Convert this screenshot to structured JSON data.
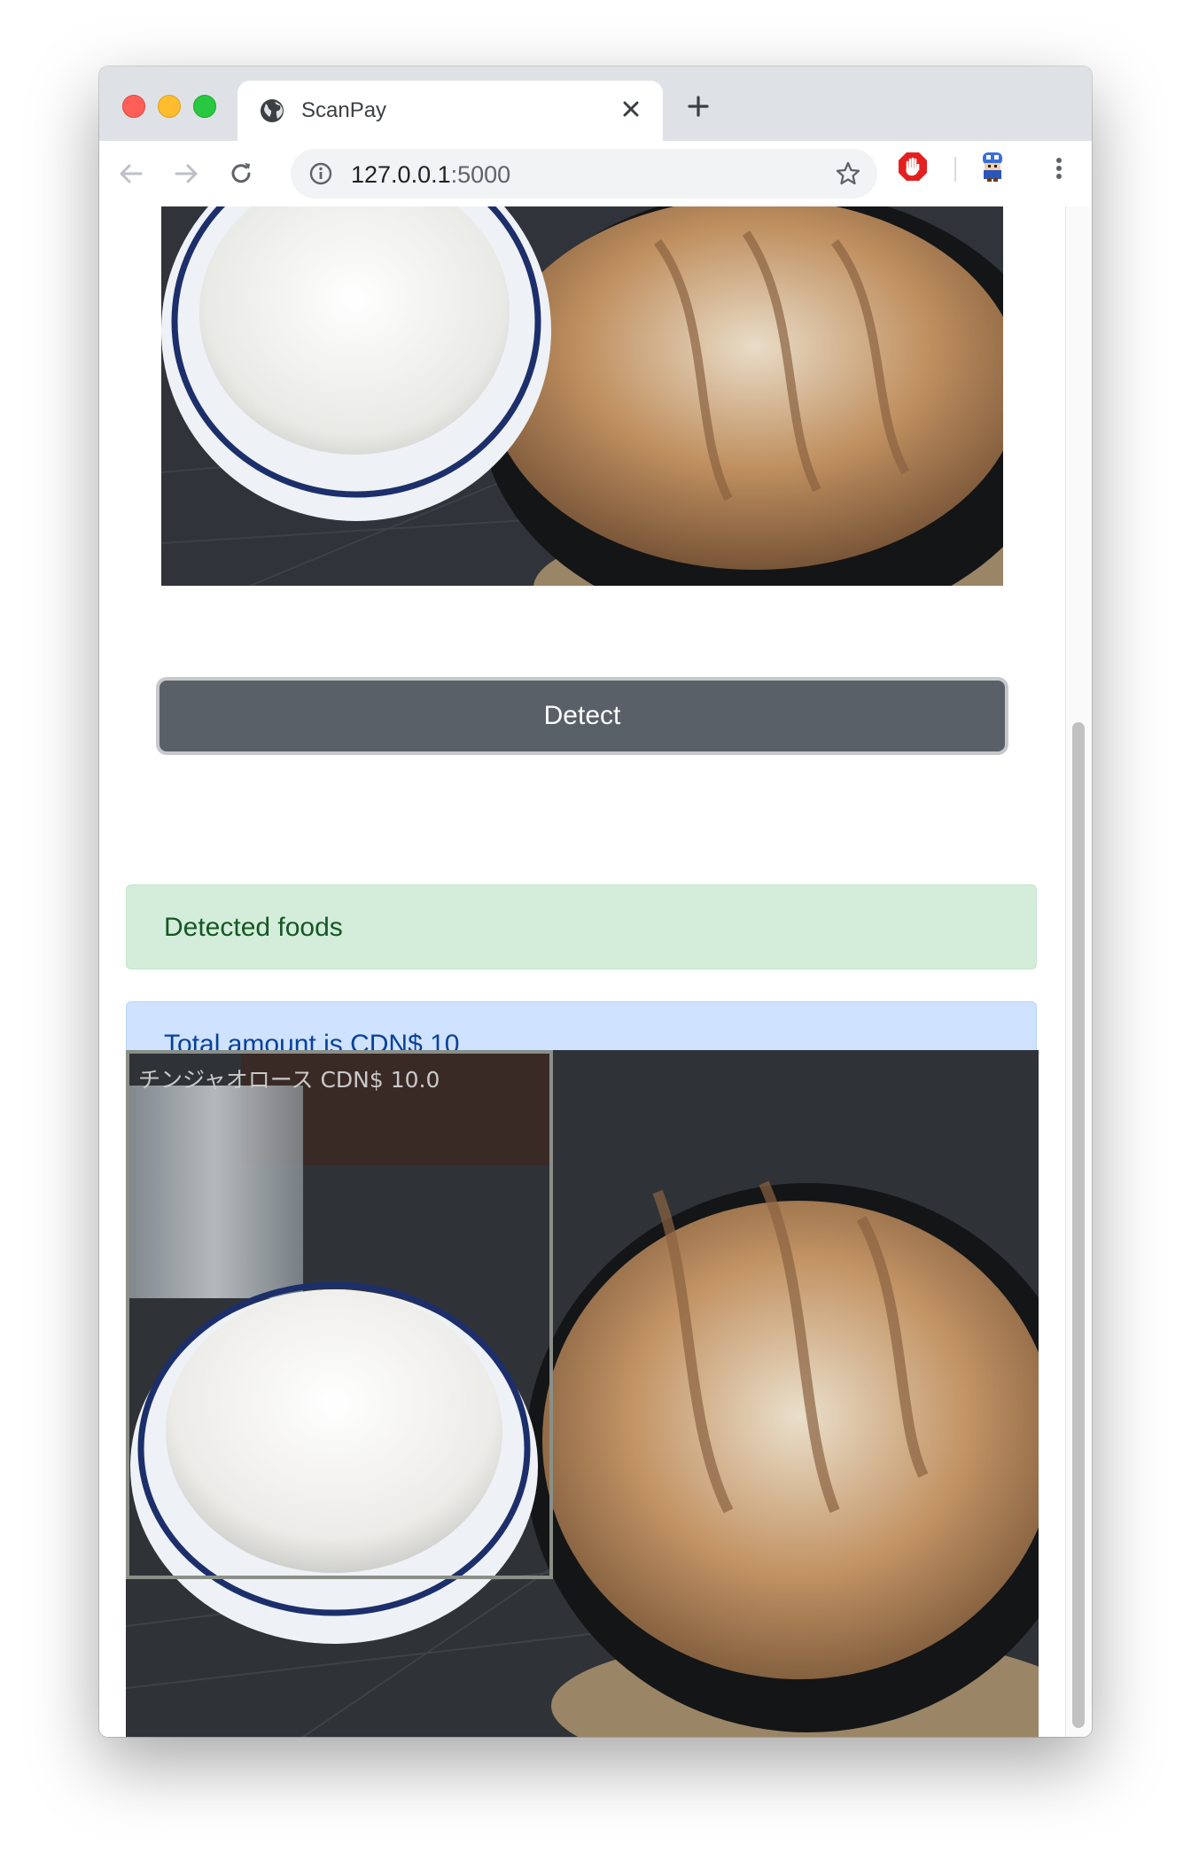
{
  "browser": {
    "tab_title": "ScanPay",
    "url_host": "127.0.0.1",
    "url_port": ":5000"
  },
  "page": {
    "detect_button": "Detect",
    "detected_foods_heading": "Detected foods",
    "total_amount": "Total amount is CDN$ 10",
    "detection": {
      "label": "チンジャオロース  CDN$ 10.0"
    }
  },
  "colors": {
    "success_bg": "#d4edda",
    "info_bg": "#cfe2ff",
    "button_bg": "#5a6068"
  },
  "icons": [
    "globe-icon",
    "close-icon",
    "plus-icon",
    "back-icon",
    "forward-icon",
    "reload-icon",
    "info-icon",
    "star-icon",
    "stop-extension-icon",
    "profile-avatar-icon",
    "kebab-menu-icon"
  ]
}
